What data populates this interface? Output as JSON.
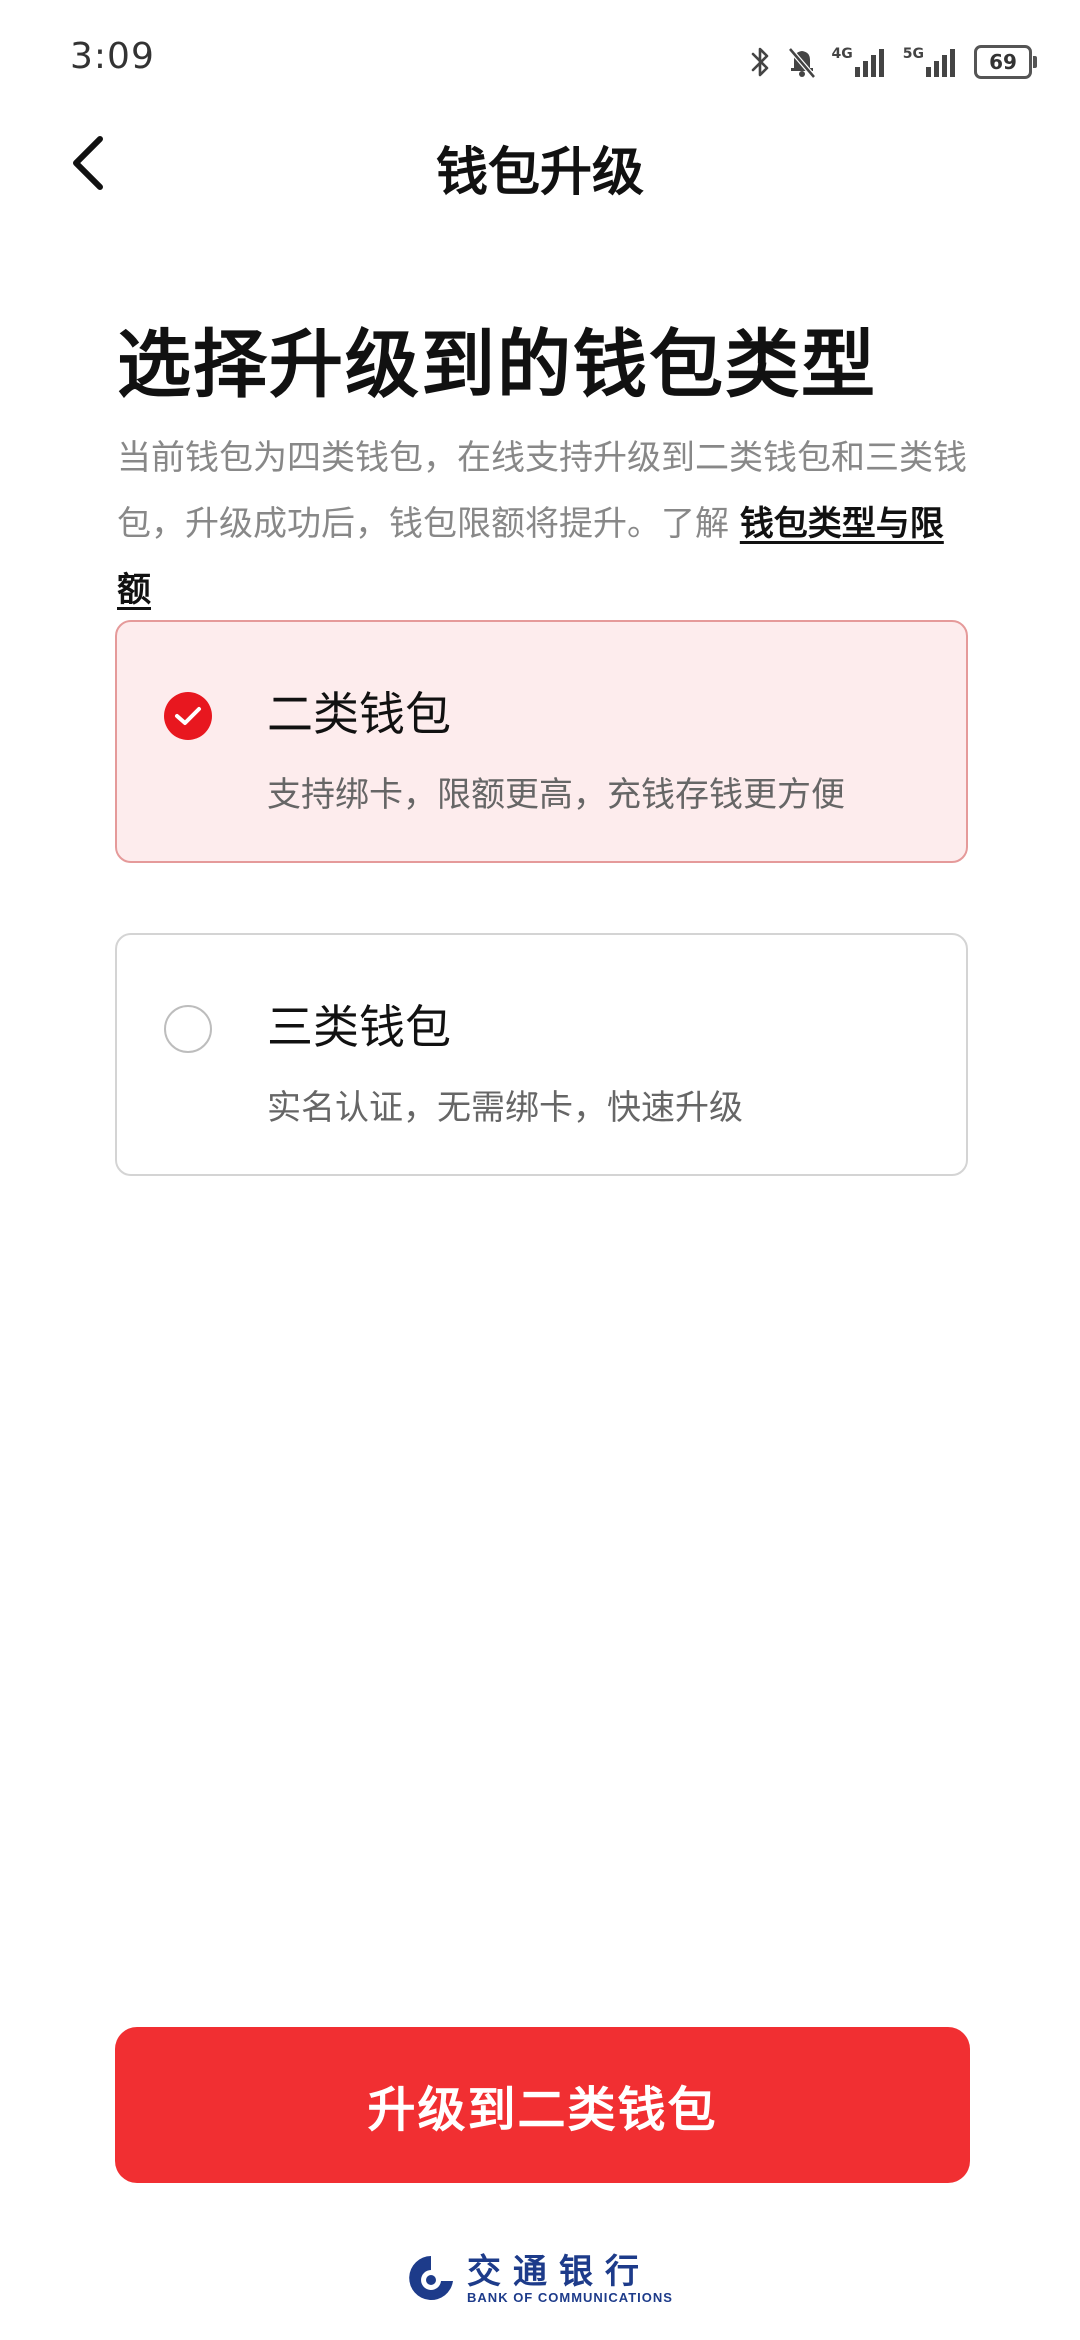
{
  "status_bar": {
    "time": "3:09",
    "net1": "4G",
    "net2": "5G",
    "battery": "69",
    "icons": [
      "bluetooth-icon",
      "bell-muted-icon",
      "signal-icon",
      "signal-icon",
      "battery-icon"
    ]
  },
  "header": {
    "title": "钱包升级",
    "back_icon": "chevron-left-icon"
  },
  "main": {
    "heading": "选择升级到的钱包类型",
    "description": "当前钱包为四类钱包，在线支持升级到二类钱包和三类钱包，升级成功后，钱包限额将提升。了解 ",
    "link": "钱包类型与限额",
    "options": [
      {
        "title": "二类钱包",
        "subtitle": "支持绑卡，限额更高，充钱存钱更方便",
        "selected": true
      },
      {
        "title": "三类钱包",
        "subtitle": "实名认证，无需绑卡，快速升级",
        "selected": false
      }
    ],
    "primary_button": "升级到二类钱包"
  },
  "footer": {
    "logo_cn": "交通银行",
    "logo_en": "BANK OF COMMUNICATIONS"
  },
  "colors": {
    "accent": "#f12f32",
    "selected_bg": "#fdeced",
    "brand_blue": "#1d3b8a"
  }
}
